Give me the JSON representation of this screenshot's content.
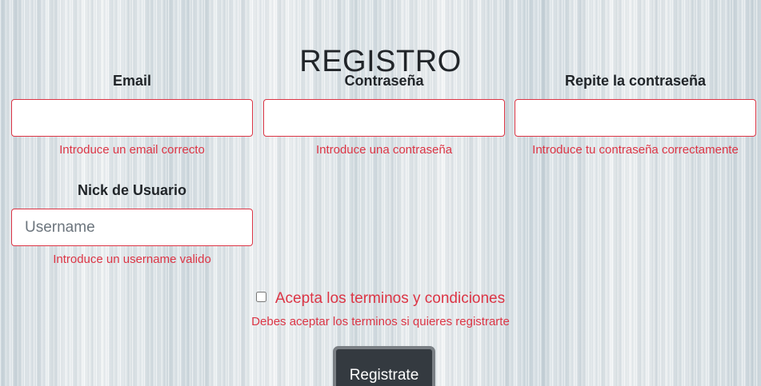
{
  "page": {
    "title": "REGISTRO"
  },
  "form": {
    "email": {
      "label": "Email",
      "value": "",
      "placeholder": "",
      "error": "Introduce un email correcto"
    },
    "password": {
      "label": "Contraseña",
      "value": "",
      "placeholder": "",
      "error": "Introduce una contraseña"
    },
    "password_repeat": {
      "label": "Repite la contraseña",
      "value": "",
      "placeholder": "",
      "error": "Introduce tu contraseña correctamente"
    },
    "nickname": {
      "label": "Nick de Usuario",
      "value": "",
      "placeholder": "Username",
      "error": "Introduce un username valido"
    },
    "terms": {
      "label": "Acepta los terminos y condiciones",
      "checked": false,
      "error": "Debes aceptar los terminos si quieres registrarte"
    },
    "submit_label": "Registrate"
  },
  "colors": {
    "error": "#dc3545",
    "button_bg": "#343a40",
    "text": "#212529"
  }
}
